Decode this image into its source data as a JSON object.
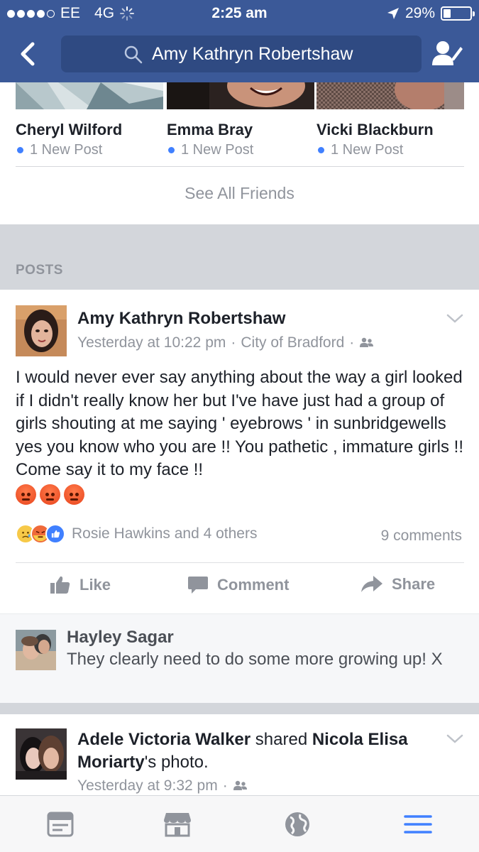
{
  "status_bar": {
    "carrier": "EE",
    "network": "4G",
    "time": "2:25 am",
    "battery": "29%",
    "battery_level": 0.29
  },
  "search": {
    "query": "Amy Kathryn Robertshaw"
  },
  "friends": [
    {
      "name": "Cheryl Wilford",
      "sub": "1 New Post"
    },
    {
      "name": "Emma Bray",
      "sub": "1 New Post"
    },
    {
      "name": "Vicki Blackburn",
      "sub": "1 New Post"
    }
  ],
  "see_all_friends": "See All Friends",
  "posts_label": "POSTS",
  "post": {
    "author": "Amy Kathryn Robertshaw",
    "time": "Yesterday at 10:22 pm",
    "separator": "·",
    "location": "City of Bradford",
    "text": "I would never ever say anything about the way a girl looked  if I didn't really know her but I've have just had a group of girls shouting at me saying ' eyebrows ' in sunbridgewells yes you know who you are !! You pathetic , immature girls !! Come say it to my face !!",
    "reactions_text": "Rosie Hawkins and 4 others",
    "comments_count": "9 comments",
    "actions": {
      "like": "Like",
      "comment": "Comment",
      "share": "Share"
    }
  },
  "comment": {
    "author": "Hayley Sagar",
    "text": "They clearly need to do some more growing up! X"
  },
  "post2": {
    "author": "Adele Victoria Walker",
    "verb": "shared",
    "shared_from": "Nicola Elisa Moriarty",
    "suffix": "'s photo.",
    "time": "Yesterday at 9:32 pm",
    "separator": "·"
  },
  "colors": {
    "brand": "#3b5998",
    "search_bg": "#2f4a82",
    "unread_dot": "#4080ff",
    "tab_active": "#4080ff"
  }
}
